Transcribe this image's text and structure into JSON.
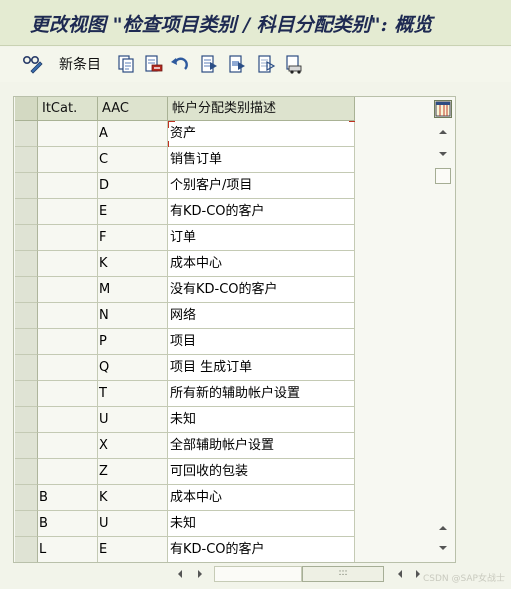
{
  "window": {
    "title": "更改视图 \"检查项目类别 / 科目分配类别\": 概览"
  },
  "toolbar": {
    "new_entries_label": "新条目",
    "icons": [
      "glasses-pencil-icon",
      "copy-icon",
      "delete-icon",
      "undo-icon",
      "select-all-icon",
      "select-block-icon",
      "deselect-all-icon",
      "transport-icon"
    ]
  },
  "table": {
    "headers": [
      "ItCat.",
      "AAC",
      "帐户分配类别描述"
    ],
    "rows": [
      {
        "itcat": "",
        "aac": "A",
        "desc": "资产"
      },
      {
        "itcat": "",
        "aac": "C",
        "desc": "销售订单"
      },
      {
        "itcat": "",
        "aac": "D",
        "desc": "个别客户/项目"
      },
      {
        "itcat": "",
        "aac": "E",
        "desc": "有KD-CO的客户"
      },
      {
        "itcat": "",
        "aac": "F",
        "desc": "订单"
      },
      {
        "itcat": "",
        "aac": "K",
        "desc": "成本中心"
      },
      {
        "itcat": "",
        "aac": "M",
        "desc": "没有KD-CO的客户"
      },
      {
        "itcat": "",
        "aac": "N",
        "desc": "网络"
      },
      {
        "itcat": "",
        "aac": "P",
        "desc": "项目"
      },
      {
        "itcat": "",
        "aac": "Q",
        "desc": "项目 生成订单"
      },
      {
        "itcat": "",
        "aac": "T",
        "desc": "所有新的辅助帐户设置"
      },
      {
        "itcat": "",
        "aac": "U",
        "desc": "未知"
      },
      {
        "itcat": "",
        "aac": "X",
        "desc": "全部辅助帐户设置"
      },
      {
        "itcat": "",
        "aac": "Z",
        "desc": "可回收的包装"
      },
      {
        "itcat": "B",
        "aac": "K",
        "desc": "成本中心"
      },
      {
        "itcat": "B",
        "aac": "U",
        "desc": "未知"
      },
      {
        "itcat": "L",
        "aac": "E",
        "desc": "有KD-CO的客户"
      }
    ]
  },
  "watermark": "CSDN @SAP女战士",
  "colors": {
    "title_text": "#1e2a52",
    "title_bg": "#e4ebd2",
    "focus_marker": "#c03020"
  }
}
